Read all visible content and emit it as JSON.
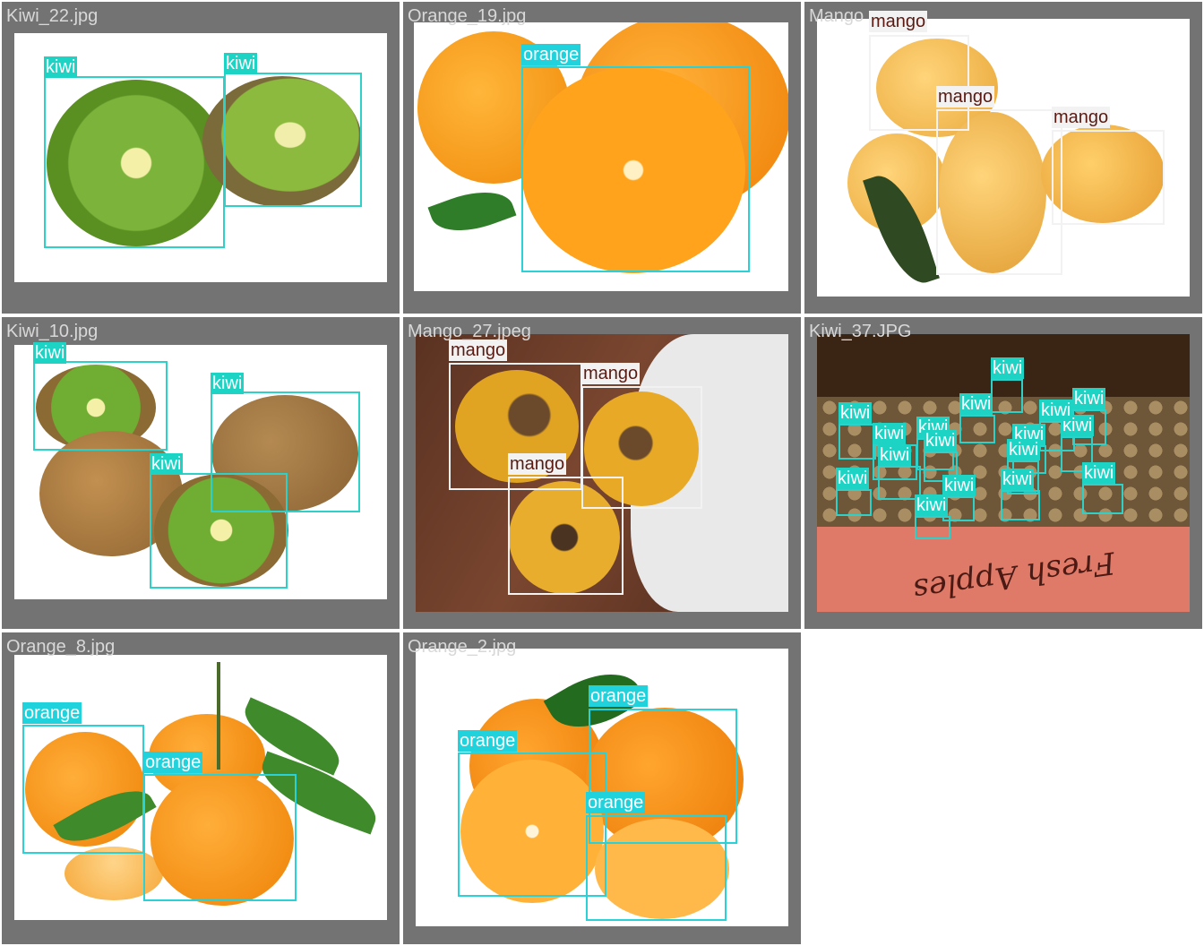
{
  "grid": {
    "tiles": [
      {
        "title": "Kiwi_22.jpg",
        "labels": [
          "kiwi",
          "kiwi"
        ]
      },
      {
        "title": "Orange_19.jpg",
        "labels": [
          "orange"
        ]
      },
      {
        "title": "Mango",
        "labels": [
          "mango",
          "mango",
          "mango"
        ]
      },
      {
        "title": "Kiwi_10.jpg",
        "labels": [
          "kiwi",
          "kiwi",
          "kiwi"
        ]
      },
      {
        "title": "Mango_27.jpeg",
        "labels": [
          "mango",
          "mango",
          "mango"
        ]
      },
      {
        "title": "Kiwi_37.JPG",
        "labels": [
          "kiwi",
          "kiwi",
          "kiwi",
          "kiwi",
          "kiwi",
          "kiwi",
          "kiwi",
          "kiwi",
          "kiwi",
          "kiwi",
          "kiwi",
          "kiwi",
          "kiwi",
          "kiwi",
          "kiwi",
          "kiwi",
          "kiwi"
        ]
      },
      {
        "title": "Orange_8.jpg",
        "labels": [
          "orange",
          "orange"
        ]
      },
      {
        "title": "Orange_2.jpg",
        "labels": [
          "orange",
          "orange",
          "orange"
        ]
      }
    ]
  },
  "photo_texts": {
    "crate_print": "Fresh Apples"
  },
  "colors": {
    "tile_background": "#737373",
    "kiwi_label": "#1dd3c4",
    "orange_label": "#20d2dc",
    "mango_label": "#f2f2f2",
    "mango_label_text": "#5a1a12"
  }
}
